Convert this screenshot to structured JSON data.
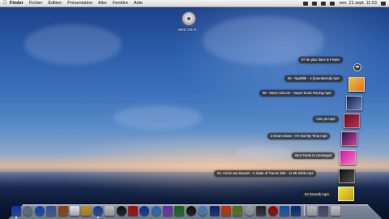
{
  "menubar": {
    "apple": "",
    "items": [
      "Finder",
      "Fichier",
      "Édition",
      "Présentation",
      "Aller",
      "Fenêtre",
      "Aide"
    ],
    "clock": "ven. 21 sept.  11:53"
  },
  "desktop": {
    "hd_label": "MAC OS X"
  },
  "stack": {
    "items": [
      "07 de plus dans le Finder",
      "05 - Nightlife - 4 [Soundmind].mp3",
      "06 - Moon Unicorn - Super Sonic Racing.mp3",
      "Cine ps.mp3",
      "3 Doors Down - It's Not My Time.mp3",
      "05-2 Feets to Centuryp3",
      "01- Armin van Buuren - A State of Trance 300 - 11-06-2008.mp3",
      "03 Smooth.mp3"
    ]
  },
  "dock": {
    "colors": [
      "#3b6fd4",
      "#9aa4b0",
      "#2f7fd8",
      "#6a8fc4",
      "#c07a3a",
      "#f2f2f2",
      "#e0c040",
      "#4a78c8",
      "#dcdcdc",
      "#3c3c3c",
      "#d03030",
      "#2a6cc4",
      "#5aa0e0",
      "#9c6ad0",
      "#4c9c4c",
      "#3a3a3a",
      "#7ab0e0",
      "#2c5ca8",
      "#e06a2a",
      "#88aa44",
      "#c8c8c8",
      "#5a5a5a",
      "#c02828",
      "#4a8ad0",
      "#3060b0",
      "#d8d8d8",
      "#8080a0",
      "#e0e0e0"
    ]
  }
}
